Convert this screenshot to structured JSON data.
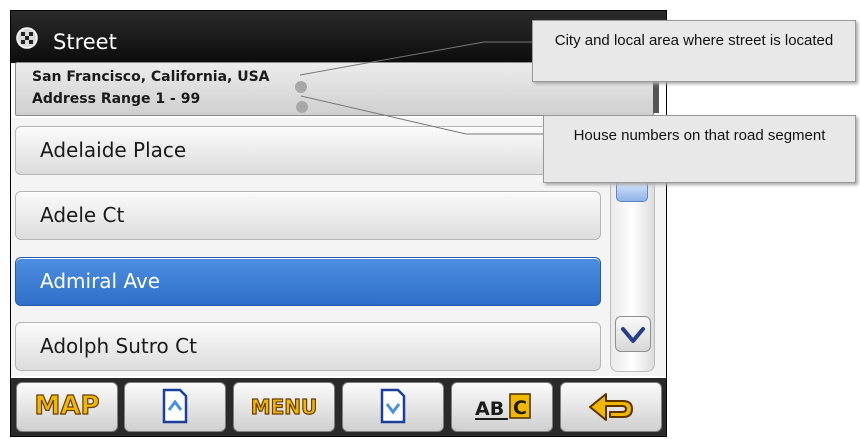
{
  "title_bar": {
    "title": "Street",
    "icon": "checkered-flag-icon"
  },
  "info_panel": {
    "location": "San Francisco, California, USA",
    "address_range": "Address Range 1 - 99"
  },
  "street_list": {
    "items": [
      {
        "label": "Adelaide Place",
        "selected": false
      },
      {
        "label": "Adele Ct",
        "selected": false
      },
      {
        "label": "Admiral Ave",
        "selected": true
      },
      {
        "label": "Adolph Sutro Ct",
        "selected": false
      }
    ],
    "selected_color": "#3a7bd5"
  },
  "scrollbar": {
    "down_icon": "chevron-down-icon"
  },
  "toolbar": {
    "buttons": [
      {
        "label": "MAP",
        "icon": null
      },
      {
        "label": "",
        "icon": "page-up-icon"
      },
      {
        "label": "MENU",
        "icon": null
      },
      {
        "label": "",
        "icon": "page-down-icon"
      },
      {
        "label": "ABC",
        "icon": "keyboard-abc-icon"
      },
      {
        "label": "",
        "icon": "back-arrow-icon"
      }
    ],
    "accent_color": "#f0b800"
  },
  "callouts": [
    {
      "text": "City and local area where street is located"
    },
    {
      "text": "House numbers on that road segment"
    }
  ]
}
